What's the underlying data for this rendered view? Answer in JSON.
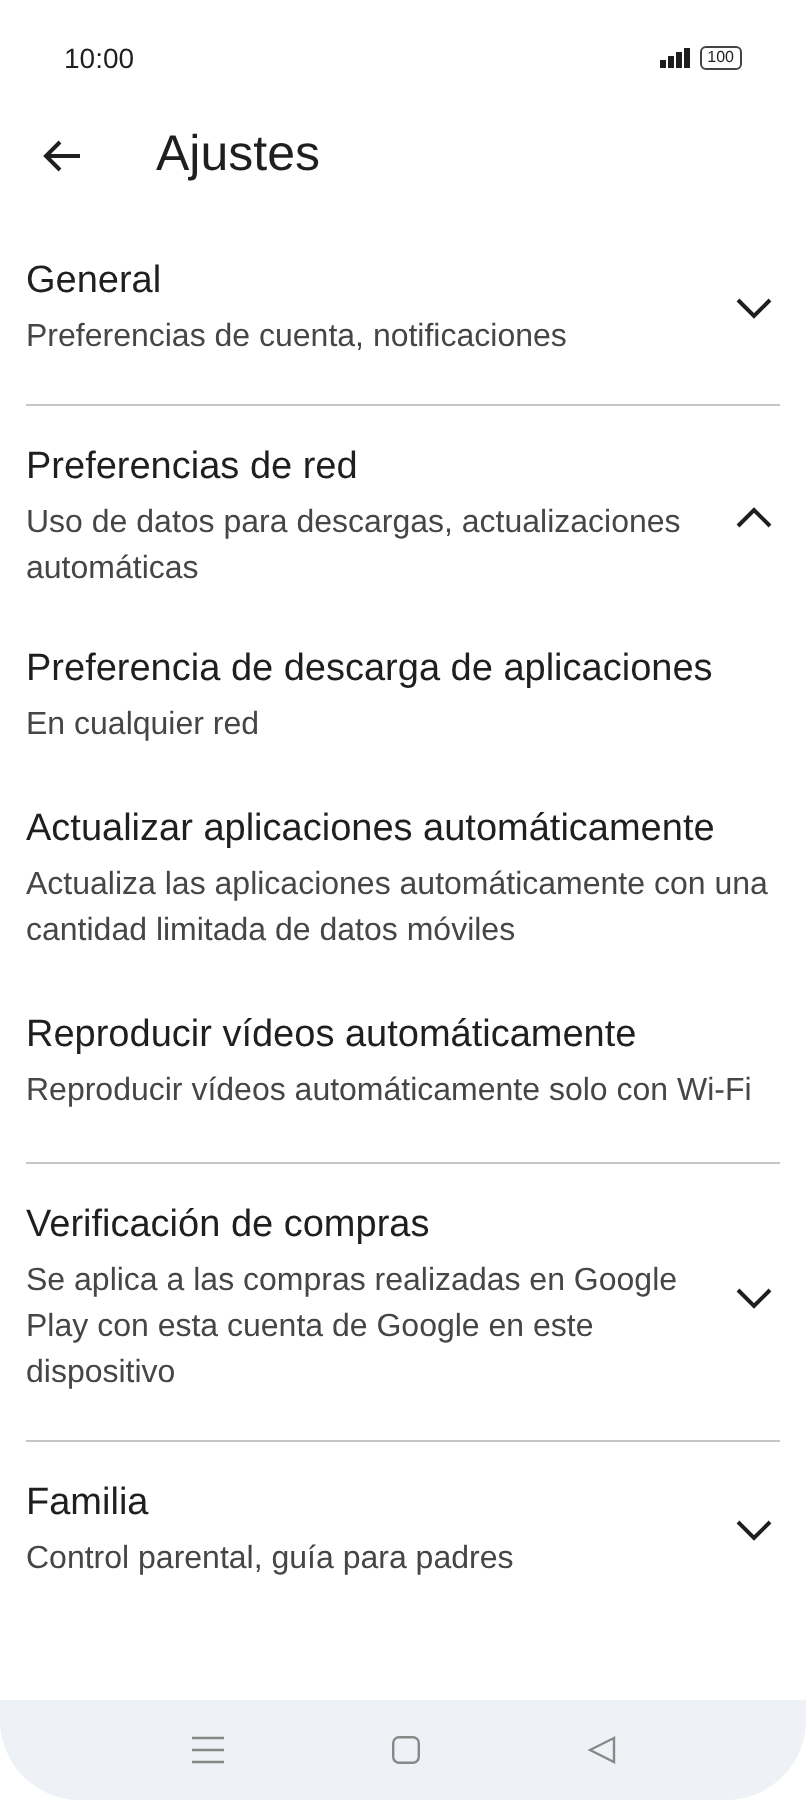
{
  "status_bar": {
    "time": "10:00",
    "battery": "100"
  },
  "header": {
    "title": "Ajustes"
  },
  "sections": [
    {
      "title": "General",
      "subtitle": "Preferencias de cuenta, notificaciones",
      "expanded": false
    },
    {
      "title": "Preferencias de red",
      "subtitle": "Uso de datos para descargas, actualizaciones automáticas",
      "expanded": true,
      "children": [
        {
          "title": "Preferencia de descarga de aplicaciones",
          "subtitle": "En cualquier red"
        },
        {
          "title": "Actualizar aplicaciones automáticamente",
          "subtitle": "Actualiza las aplicaciones automáticamente con una cantidad limitada de datos móviles"
        },
        {
          "title": "Reproducir vídeos automáticamente",
          "subtitle": "Reproducir vídeos automáticamente solo con Wi-Fi"
        }
      ]
    },
    {
      "title": "Verificación de compras",
      "subtitle": "Se aplica a las compras realizadas en Google Play con esta cuenta de Google en este dispositivo",
      "expanded": false
    },
    {
      "title": "Familia",
      "subtitle": "Control parental, guía para padres",
      "expanded": false
    }
  ]
}
